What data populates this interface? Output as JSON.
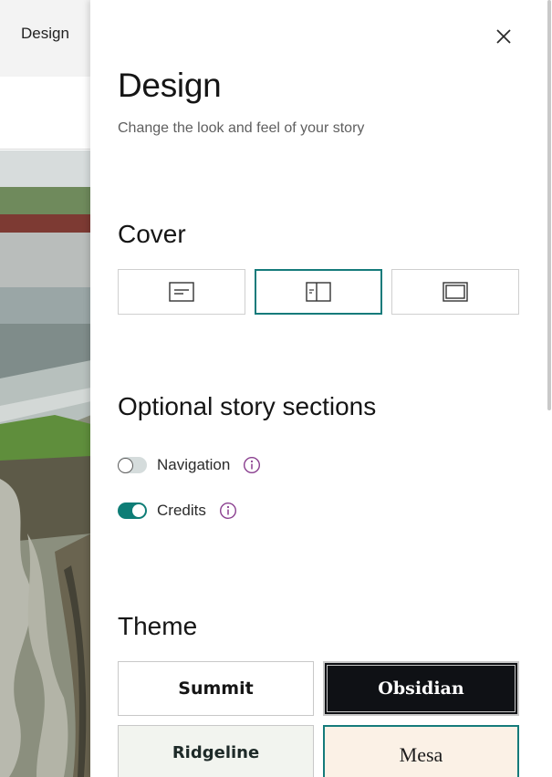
{
  "background": {
    "topbar_label": "Design"
  },
  "panel": {
    "title": "Design",
    "subtitle": "Change the look and feel of your story",
    "close_icon": "close-icon"
  },
  "cover": {
    "heading": "Cover",
    "options": [
      {
        "icon": "cover-minimal-icon",
        "selected": false
      },
      {
        "icon": "cover-side-by-side-icon",
        "selected": true
      },
      {
        "icon": "cover-full-icon",
        "selected": false
      }
    ]
  },
  "sections": {
    "heading": "Optional story sections",
    "items": [
      {
        "label": "Navigation",
        "enabled": false,
        "info_icon": "info-icon"
      },
      {
        "label": "Credits",
        "enabled": true,
        "info_icon": "info-icon"
      }
    ]
  },
  "theme": {
    "heading": "Theme",
    "options": [
      {
        "label": "Summit"
      },
      {
        "label": "Obsidian"
      },
      {
        "label": "Ridgeline"
      },
      {
        "label": "Mesa",
        "selected": true
      }
    ]
  },
  "colors": {
    "accent": "#157b7b",
    "toggle_on": "#0e7d76",
    "info_icon": "#8a3f8f"
  }
}
